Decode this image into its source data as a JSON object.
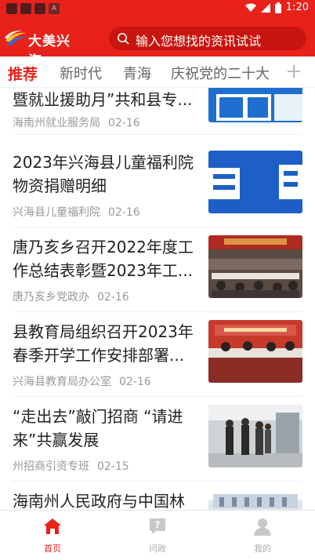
{
  "status_bar": {
    "time": "1:20"
  },
  "header": {
    "logo_text": "大美兴海",
    "search_placeholder": "输入您想找的资讯试试"
  },
  "tabs": [
    {
      "label": "推荐",
      "active": true
    },
    {
      "label": "新时代",
      "active": false
    },
    {
      "label": "青海",
      "active": false
    },
    {
      "label": "庆祝党的二十大",
      "active": false
    }
  ],
  "tabs_more_label": "+",
  "articles": [
    {
      "title": "暨就业援助月”共和县专...",
      "source": "海南州就业服务局",
      "date": "02-16",
      "thumb": "notice-graphic"
    },
    {
      "title": "2023年兴海县儿童福利院物资捐赠明细",
      "source": "兴海县儿童福利院",
      "date": "02-16",
      "thumb": "attention-graphic"
    },
    {
      "title": "唐乃亥乡召开2022年度工作总结表彰暨2023年工...",
      "source": "唐乃亥乡党政办",
      "date": "02-16",
      "thumb": "meeting-photo"
    },
    {
      "title": "县教育局组织召开2023年春季开学工作安排部署...",
      "source": "兴海县教育局办公室",
      "date": "02-16",
      "thumb": "conference-photo"
    },
    {
      "title": "“走出去”敲门招商 “请进来”共赢发展",
      "source": "州招商引资专班",
      "date": "02-15",
      "thumb": "factory-visit-photo"
    },
    {
      "title": "海南州人民政府与中国林",
      "source": "",
      "date": "",
      "thumb": "building-photo"
    }
  ],
  "bottom_nav": [
    {
      "label": "首页",
      "icon": "home-icon",
      "active": true
    },
    {
      "label": "问政",
      "icon": "question-icon",
      "active": false
    },
    {
      "label": "我的",
      "icon": "user-icon",
      "active": false
    }
  ],
  "colors": {
    "brand_red": "#e8221b",
    "text_dark": "#222222",
    "text_meta": "#999999"
  }
}
